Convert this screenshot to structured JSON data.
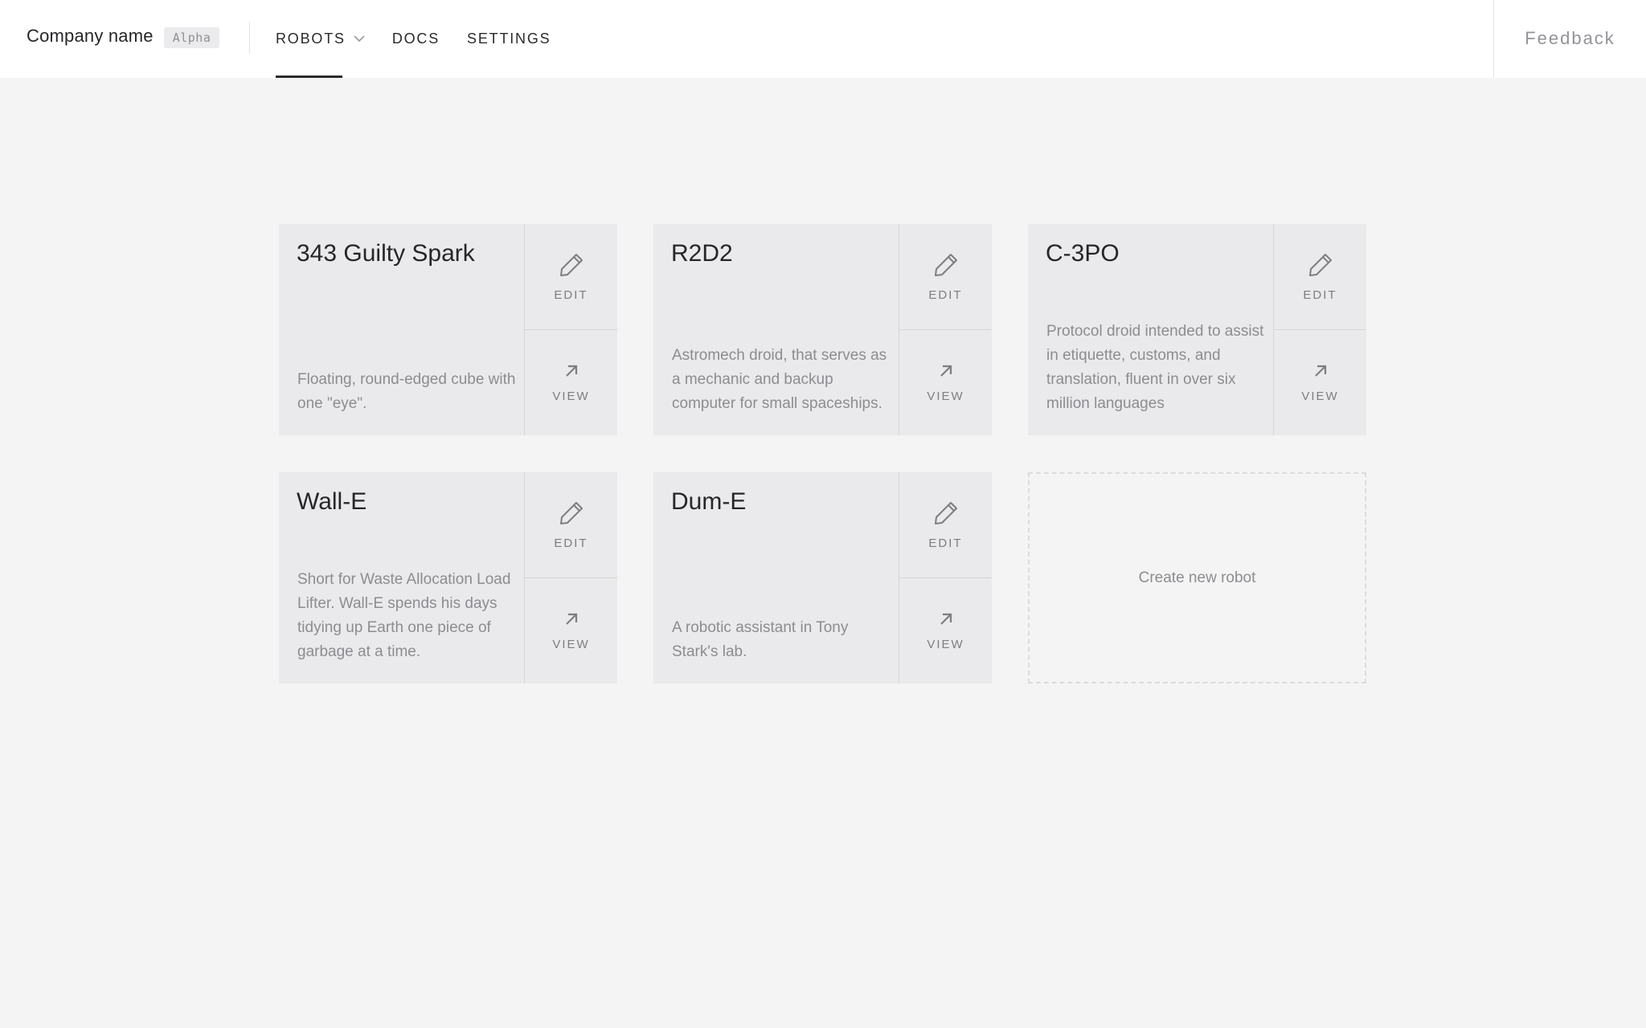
{
  "header": {
    "company_name": "Company name",
    "badge": "Alpha",
    "nav": [
      {
        "label": "ROBOTS",
        "active": true,
        "has_dropdown": true
      },
      {
        "label": "DOCS",
        "active": false
      },
      {
        "label": "SETTINGS",
        "active": false
      }
    ],
    "feedback_label": "Feedback"
  },
  "robots": [
    {
      "name": "343 Guilty Spark",
      "description": "Floating, round-edged cube with one \"eye\".",
      "edit_label": "EDIT",
      "view_label": "VIEW"
    },
    {
      "name": "R2D2",
      "description": "Astromech droid, that serves as a mechanic and backup computer for small spaceships.",
      "edit_label": "EDIT",
      "view_label": "VIEW"
    },
    {
      "name": "C-3PO",
      "description": "Protocol droid intended to assist in etiquette, customs, and translation, fluent in over six million languages",
      "edit_label": "EDIT",
      "view_label": "VIEW"
    },
    {
      "name": "Wall-E",
      "description": "Short for Waste Allocation Load Lifter. Wall-E spends his days tidying up Earth one piece of garbage at a time.",
      "edit_label": "EDIT",
      "view_label": "VIEW"
    },
    {
      "name": "Dum-E",
      "description": "A robotic assistant in Tony Stark's lab.",
      "edit_label": "EDIT",
      "view_label": "VIEW"
    }
  ],
  "create_label": "Create new robot",
  "icons": {
    "edit": "pencil-icon",
    "view": "arrow-up-right-icon",
    "dropdown": "chevron-down-icon"
  },
  "colors": {
    "background": "#f4f4f4",
    "card": "#eaeaec",
    "text": "#2b2b2d",
    "muted": "#8c8c91"
  }
}
